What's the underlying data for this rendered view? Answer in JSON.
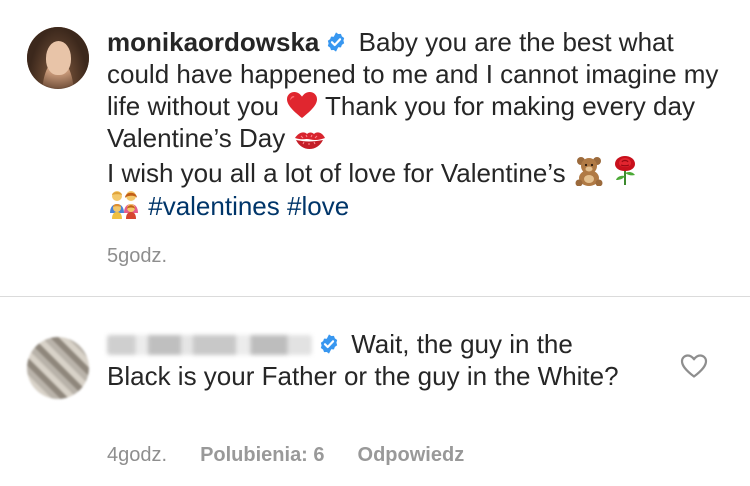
{
  "post": {
    "username": "monikaordowska",
    "caption_line1": "Baby you are the best what could have happened to me and I cannot imagine my life without you",
    "caption_line2": "Thank you for making every day Valentine’s Day",
    "caption_line3": "I wish you all a lot of love for Valentine’s",
    "hashtags": "#valentines #love",
    "time": "5godz.",
    "icons": {
      "verified": "verified-badge-icon",
      "heart": "red-heart-emoji",
      "kiss": "kiss-mark-emoji",
      "bear": "teddy-bear-emoji",
      "rose": "rose-emoji",
      "family": "family-emoji"
    }
  },
  "comment": {
    "text": "Wait, the guy in the Black is your Father or the guy in the White?",
    "time": "4godz.",
    "likes": "Polubienia: 6",
    "reply": "Odpowiedz",
    "icons": {
      "verified": "verified-badge-icon",
      "like": "heart-outline-icon"
    }
  },
  "colors": {
    "text": "#262626",
    "meta": "#8e8e8e",
    "hashtag": "#003569",
    "verified": "#3897f0",
    "divider": "#dbdbdb"
  }
}
